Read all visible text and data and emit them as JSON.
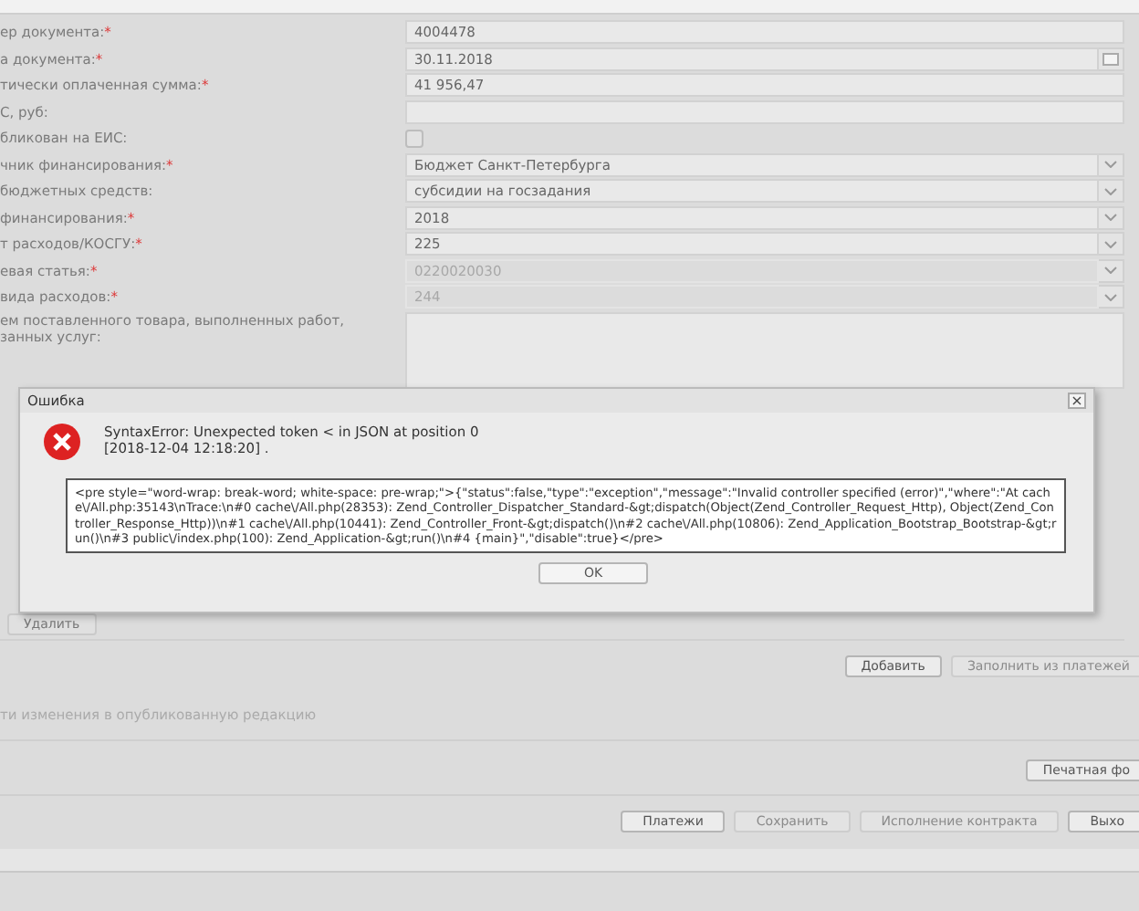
{
  "form": {
    "fields": [
      {
        "label": "ер документа:",
        "required_mark": "*",
        "kind": "text",
        "value": "4004478",
        "disabled": false
      },
      {
        "label": "а документа:",
        "required_mark": "*",
        "kind": "date",
        "value": "30.11.2018",
        "disabled": false
      },
      {
        "label": "тически оплаченная сумма:",
        "required_mark": "*",
        "kind": "text",
        "value": "41 956,47",
        "disabled": false
      },
      {
        "label": "С, руб:",
        "kind": "text",
        "disabled": false
      },
      {
        "label": "бликован на ЕИС:",
        "kind": "checkbox",
        "checked": false,
        "disabled": true
      },
      {
        "label": "чник финансирования:",
        "required_mark": "*",
        "kind": "select",
        "value": "Бюджет Санкт-Петербурга",
        "disabled": false
      },
      {
        "label": "бюджетных средств:",
        "kind": "select",
        "value": "субсидии на госзадания",
        "disabled": false
      },
      {
        "label": "финансирования:",
        "required_mark": "*",
        "kind": "select",
        "value": "2018",
        "disabled": false
      },
      {
        "label": "т расходов/КОСГУ:",
        "required_mark": "*",
        "kind": "select",
        "value": "225",
        "disabled": false
      },
      {
        "label": "евая статья:",
        "required_mark": "*",
        "kind": "select",
        "value": "0220020030",
        "disabled": true
      },
      {
        "label": "вида расходов:",
        "required_mark": "*",
        "kind": "select",
        "value": "244",
        "disabled": true
      },
      {
        "label": "ем поставленного товара, выполненных работ, занных услуг:",
        "kind": "textarea",
        "disabled": false
      }
    ]
  },
  "delete_button": "Удалить",
  "payments_buttons": [
    {
      "label": "Добавить",
      "disabled": false
    },
    {
      "label": "Заполнить из платежей",
      "disabled": true
    }
  ],
  "publish_note": "ти изменения в опубликованную редакцию",
  "print_button": "Печатная фо",
  "footer_buttons": [
    {
      "label": "Платежи",
      "disabled": false
    },
    {
      "label": "Сохранить",
      "disabled": true
    },
    {
      "label": "Исполнение контракта",
      "disabled": true
    },
    {
      "label": "Выхо",
      "disabled": false
    }
  ],
  "dialog": {
    "title": "Ошибка",
    "close": "×",
    "message": "SyntaxError: Unexpected token < in JSON at position 0",
    "timestamp": "[2018-12-04 12:18:20] .",
    "details": "<pre style=\"word-wrap: break-word; white-space: pre-wrap;\">{\"status\":false,\"type\":\"exception\",\"message\":\"Invalid controller specified (error)\",\"where\":\"At cache\\/All.php:35143\\nTrace:\\n#0 cache\\/All.php(28353): Zend_Controller_Dispatcher_Standard-&gt;dispatch(Object(Zend_Controller_Request_Http), Object(Zend_Controller_Response_Http))\\n#1 cache\\/All.php(10441): Zend_Controller_Front-&gt;dispatch()\\n#2 cache\\/All.php(10806): Zend_Application_Bootstrap_Bootstrap-&gt;run()\\n#3 public\\/index.php(100): Zend_Application-&gt;run()\\n#4 {main}\",\"disable\":true}</pre>",
    "ok": "OK"
  }
}
